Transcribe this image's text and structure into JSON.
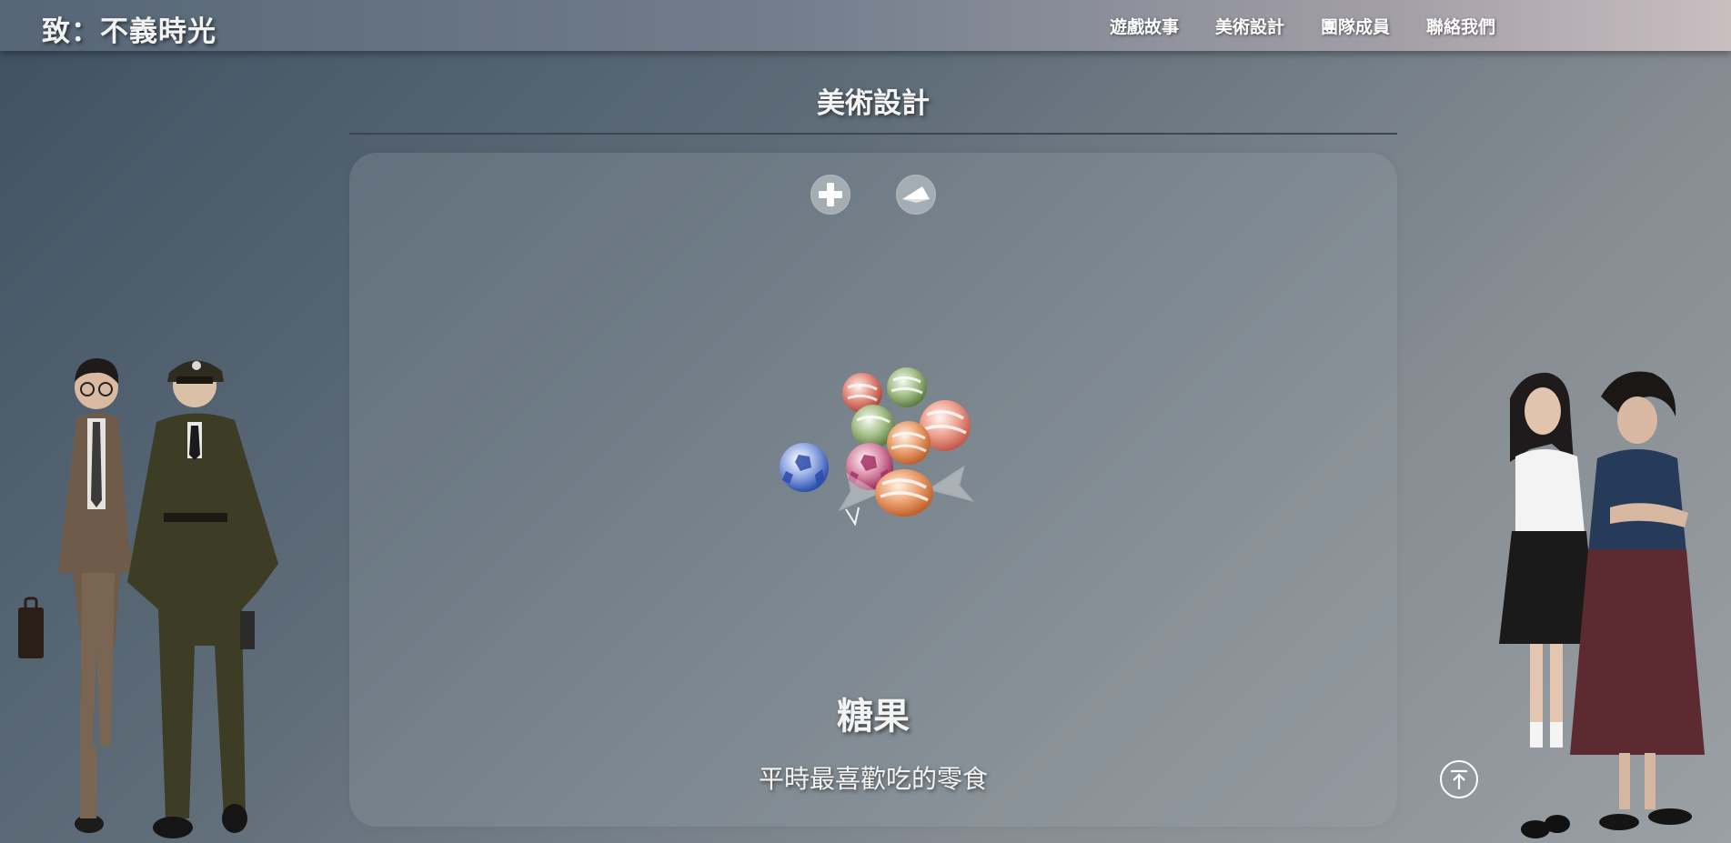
{
  "header": {
    "site_title": "致：不義時光",
    "nav": [
      {
        "label": "遊戲故事"
      },
      {
        "label": "美術設計"
      },
      {
        "label": "團隊成員"
      },
      {
        "label": "聯絡我們"
      }
    ]
  },
  "section": {
    "title": "美術設計"
  },
  "panel": {
    "buttons": [
      {
        "icon": "plus-icon"
      },
      {
        "icon": "paper-plane-icon"
      }
    ],
    "item_image_icon": "candy-illustration",
    "item_name": "糖果",
    "item_description": "平時最喜歡吃的零食"
  },
  "back_to_top_icon": "arrow-up-icon",
  "characters": {
    "left_icon": "male-characters-illustration",
    "right_icon": "female-characters-illustration"
  },
  "colors": {
    "text": "#f3f3f3",
    "panel_button": "#a5adb4"
  }
}
